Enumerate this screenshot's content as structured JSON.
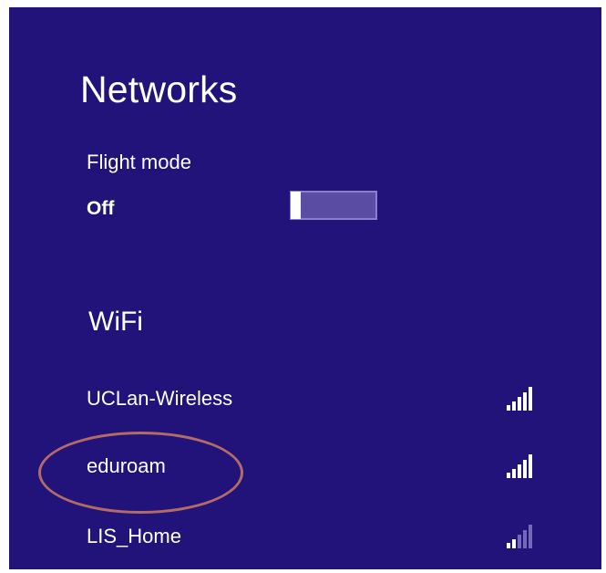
{
  "networks_panel": {
    "title": "Networks",
    "flight_mode": {
      "label": "Flight mode",
      "state": "Off",
      "enabled": false
    },
    "wifi": {
      "heading": "WiFi",
      "items": [
        {
          "name": "UCLan-Wireless",
          "signal_bars": 5,
          "signal_strength": 5,
          "icon": "wifi-signal-icon"
        },
        {
          "name": "eduroam",
          "signal_bars": 5,
          "signal_strength": 5,
          "icon": "wifi-signal-icon"
        },
        {
          "name": "LIS_Home",
          "signal_bars": 5,
          "signal_strength": 2,
          "icon": "wifi-signal-icon"
        }
      ]
    }
  },
  "colors": {
    "panel_background": "#22137a",
    "text": "#ffffff",
    "toggle_track": "#5c4ea8",
    "toggle_thumb": "#ffffff",
    "signal_dim": "#7468b8",
    "annotation_ellipse": "#b26b66"
  },
  "annotation": {
    "type": "ellipse",
    "highlights": "eduroam"
  }
}
